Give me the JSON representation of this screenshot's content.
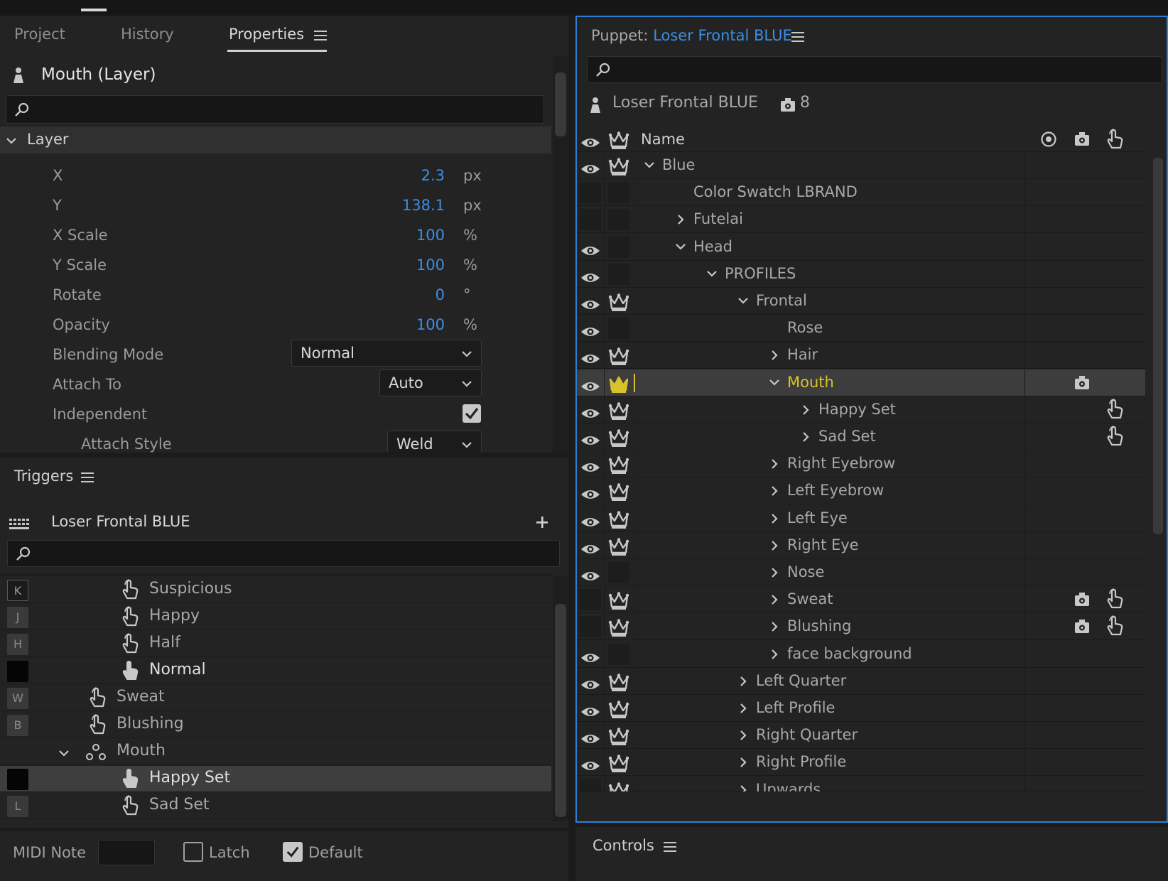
{
  "properties_panel": {
    "tabs": [
      "Project",
      "History",
      "Properties"
    ],
    "active_tab": "Properties",
    "layer_title": "Mouth (Layer)",
    "section": "Layer",
    "rows": [
      {
        "label": "X",
        "value": "2.3",
        "unit": "px"
      },
      {
        "label": "Y",
        "value": "138.1",
        "unit": "px"
      },
      {
        "label": "X Scale",
        "value": "100",
        "unit": "%"
      },
      {
        "label": "Y Scale",
        "value": "100",
        "unit": "%"
      },
      {
        "label": "Rotate",
        "value": "0",
        "unit": "°"
      },
      {
        "label": "Opacity",
        "value": "100",
        "unit": "%"
      }
    ],
    "blending_mode": {
      "label": "Blending Mode",
      "value": "Normal"
    },
    "attach_to": {
      "label": "Attach To",
      "value": "Auto"
    },
    "independent": {
      "label": "Independent",
      "checked": true
    },
    "attach_style": {
      "label": "Attach Style",
      "value": "Weld"
    }
  },
  "triggers_panel": {
    "title": "Triggers",
    "puppet_name": "Loser Frontal BLUE",
    "rows": [
      {
        "key": "K",
        "label": "Suspicious",
        "style": "outline"
      },
      {
        "key": "J",
        "label": "Happy",
        "style": "gray"
      },
      {
        "key": "H",
        "label": "Half",
        "style": "gray"
      },
      {
        "key": "",
        "label": "Normal",
        "style": "black"
      },
      {
        "key": "W",
        "label": "Sweat",
        "style": "gray"
      },
      {
        "key": "B",
        "label": "Blushing",
        "style": "gray"
      },
      {
        "key": "",
        "label": "Mouth",
        "style": "none"
      },
      {
        "key": "",
        "label": "Happy Set",
        "style": "black"
      },
      {
        "key": "L",
        "label": "Sad Set",
        "style": "gray"
      }
    ],
    "midi_note_label": "MIDI Note",
    "latch_label": "Latch",
    "latch_checked": false,
    "default_label": "Default",
    "default_checked": true
  },
  "puppet_panel": {
    "title_prefix": "Puppet:",
    "title_name": "Loser Frontal BLUE",
    "puppet_name": "Loser Frontal BLUE",
    "handle_count": "8",
    "column_name": "Name",
    "rows": [
      {
        "name": "Blue",
        "eye": true,
        "crown": true,
        "depth": 0,
        "twisty": "open"
      },
      {
        "name": "Color Swatch LBRAND",
        "eye": false,
        "crown": false,
        "depth": 1,
        "twisty": "none"
      },
      {
        "name": "Futelai",
        "eye": false,
        "crown": false,
        "depth": 1,
        "twisty": "closed"
      },
      {
        "name": "Head",
        "eye": true,
        "crown": false,
        "depth": 1,
        "twisty": "open"
      },
      {
        "name": "PROFILES",
        "eye": true,
        "crown": false,
        "depth": 2,
        "twisty": "open"
      },
      {
        "name": "Frontal",
        "eye": true,
        "crown": true,
        "depth": 3,
        "twisty": "open"
      },
      {
        "name": "Rose",
        "eye": true,
        "crown": false,
        "depth": 4,
        "twisty": "none"
      },
      {
        "name": "Hair",
        "eye": true,
        "crown": true,
        "depth": 4,
        "twisty": "closed"
      },
      {
        "name": "Mouth",
        "eye": true,
        "crown": true,
        "depth": 4,
        "twisty": "open",
        "selected": true,
        "handle": true
      },
      {
        "name": "Happy Set",
        "eye": true,
        "crown": true,
        "depth": 5,
        "twisty": "closed",
        "trigger": true
      },
      {
        "name": "Sad Set",
        "eye": true,
        "crown": true,
        "depth": 5,
        "twisty": "closed",
        "trigger": true
      },
      {
        "name": "Right Eyebrow",
        "eye": true,
        "crown": true,
        "depth": 4,
        "twisty": "closed"
      },
      {
        "name": "Left Eyebrow",
        "eye": true,
        "crown": true,
        "depth": 4,
        "twisty": "closed"
      },
      {
        "name": "Left Eye",
        "eye": true,
        "crown": true,
        "depth": 4,
        "twisty": "closed"
      },
      {
        "name": "Right Eye",
        "eye": true,
        "crown": true,
        "depth": 4,
        "twisty": "closed"
      },
      {
        "name": "Nose",
        "eye": true,
        "crown": false,
        "depth": 4,
        "twisty": "closed"
      },
      {
        "name": "Sweat",
        "eye": false,
        "crown": true,
        "depth": 4,
        "twisty": "closed",
        "handle": true,
        "trigger": true
      },
      {
        "name": "Blushing",
        "eye": false,
        "crown": true,
        "depth": 4,
        "twisty": "closed",
        "handle": true,
        "trigger": true
      },
      {
        "name": "face background",
        "eye": true,
        "crown": false,
        "depth": 4,
        "twisty": "closed"
      },
      {
        "name": "Left Quarter",
        "eye": true,
        "crown": true,
        "depth": 3,
        "twisty": "closed"
      },
      {
        "name": "Left Profile",
        "eye": true,
        "crown": true,
        "depth": 3,
        "twisty": "closed"
      },
      {
        "name": "Right Quarter",
        "eye": true,
        "crown": true,
        "depth": 3,
        "twisty": "closed"
      },
      {
        "name": "Right Profile",
        "eye": true,
        "crown": true,
        "depth": 3,
        "twisty": "closed"
      },
      {
        "name": "Upwards",
        "eye": false,
        "crown": true,
        "depth": 3,
        "twisty": "closed"
      }
    ]
  },
  "controls_panel": {
    "title": "Controls"
  },
  "colors": {
    "accent": "#3b8ee6",
    "selected_text": "#d8c22c",
    "panel_bg": "#232323"
  }
}
